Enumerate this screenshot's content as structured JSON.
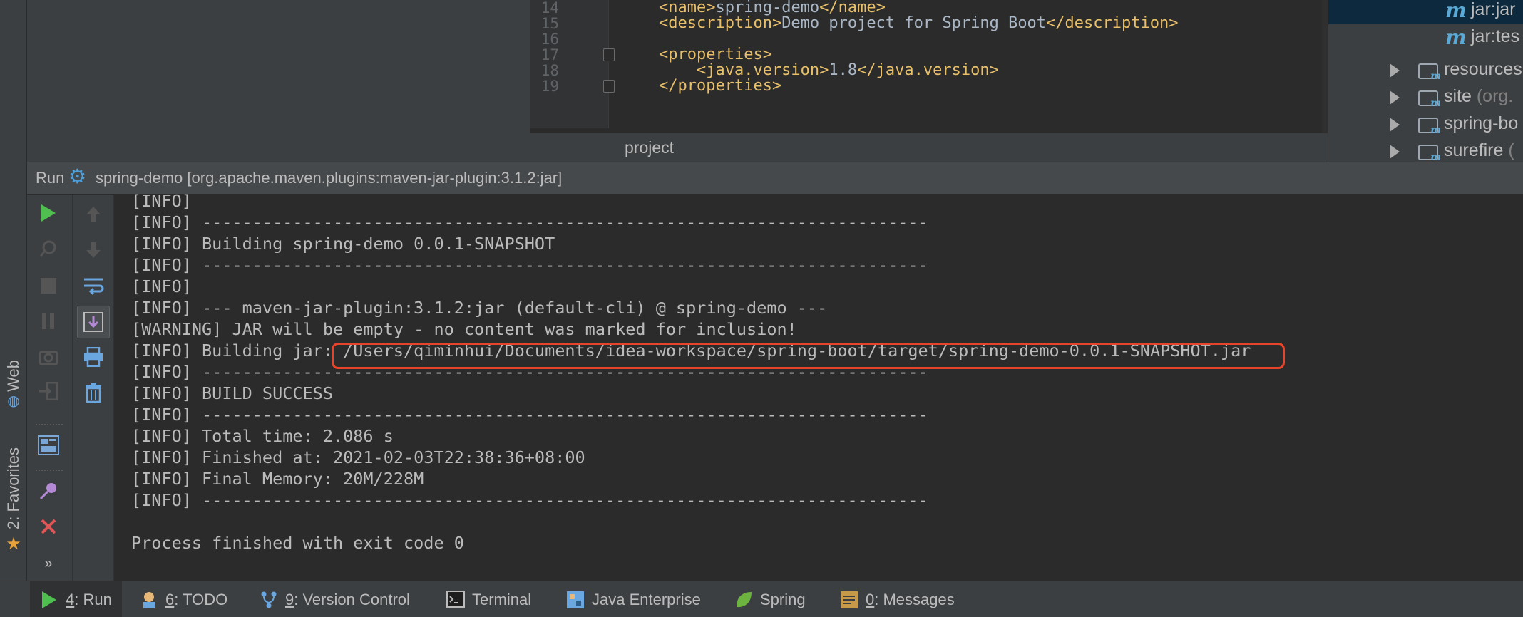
{
  "editor": {
    "lines": [
      {
        "no": "14",
        "parts": [
          [
            "tag",
            "<name>"
          ],
          [
            "txt",
            "spring-demo"
          ],
          [
            "tag",
            "</name>"
          ]
        ]
      },
      {
        "no": "15",
        "parts": [
          [
            "tag",
            "<description>"
          ],
          [
            "txt",
            "Demo project for Spring Boot"
          ],
          [
            "tag",
            "</description>"
          ]
        ]
      },
      {
        "no": "16",
        "parts": []
      },
      {
        "no": "17",
        "parts": [
          [
            "tag",
            "<properties>"
          ]
        ]
      },
      {
        "no": "18",
        "parts": [
          [
            "tag",
            "    <java.version>"
          ],
          [
            "txt",
            "1.8"
          ],
          [
            "tag",
            "</java.version>"
          ]
        ]
      },
      {
        "no": "19",
        "parts": [
          [
            "tag",
            "</properties>"
          ]
        ]
      }
    ],
    "breadcrumb": "project"
  },
  "maven_tree": {
    "items": [
      {
        "label": "jar:jar",
        "kind": "goal",
        "selected": true
      },
      {
        "label": "jar:tes",
        "kind": "goal",
        "selected": false
      },
      {
        "label": "resources",
        "kind": "plugin",
        "suffix": ""
      },
      {
        "label": "site",
        "kind": "plugin",
        "suffix": " (org."
      },
      {
        "label": "spring-bo",
        "kind": "plugin",
        "suffix": ""
      },
      {
        "label": "surefire",
        "kind": "plugin",
        "suffix": " ("
      }
    ]
  },
  "left_stripe": {
    "web": "Web",
    "favorites": "2: Favorites"
  },
  "run_panel": {
    "title": "Run",
    "config": "spring-demo [org.apache.maven.plugins:maven-jar-plugin:3.1.2:jar]"
  },
  "console": {
    "lines": [
      "[INFO]",
      "[INFO] ------------------------------------------------------------------------",
      "[INFO] Building spring-demo 0.0.1-SNAPSHOT",
      "[INFO] ------------------------------------------------------------------------",
      "[INFO]",
      "[INFO] --- maven-jar-plugin:3.1.2:jar (default-cli) @ spring-demo ---",
      "[WARNING] JAR will be empty - no content was marked for inclusion!",
      "[INFO] Building jar: /Users/qiminhui/Documents/idea-workspace/spring-boot/target/spring-demo-0.0.1-SNAPSHOT.jar",
      "[INFO] ------------------------------------------------------------------------",
      "[INFO] BUILD SUCCESS",
      "[INFO] ------------------------------------------------------------------------",
      "[INFO] Total time: 2.086 s",
      "[INFO] Finished at: 2021-02-03T22:38:36+08:00",
      "[INFO] Final Memory: 20M/228M",
      "[INFO] ------------------------------------------------------------------------",
      "",
      "Process finished with exit code 0"
    ]
  },
  "bottom_tabs": [
    {
      "key": "4",
      "label": ": Run",
      "icon": "run-icon",
      "active": true
    },
    {
      "key": "6",
      "label": ": TODO",
      "icon": "todo-icon",
      "active": false
    },
    {
      "key": "9",
      "label": ": Version Control",
      "icon": "version-control-icon",
      "active": false
    },
    {
      "key": "",
      "label": "Terminal",
      "icon": "terminal-icon",
      "active": false
    },
    {
      "key": "",
      "label": "Java Enterprise",
      "icon": "java-enterprise-icon",
      "active": false
    },
    {
      "key": "",
      "label": "Spring",
      "icon": "spring-icon",
      "active": false
    },
    {
      "key": "0",
      "label": ": Messages",
      "icon": "messages-icon",
      "active": false
    }
  ],
  "colors": {
    "background": "#2b2b2b",
    "panel": "#3c3f41",
    "xml_tag": "#e8bf6a",
    "highlight_box": "#e8432b",
    "run_green": "#4fbf4f",
    "stop_red": "#e05555"
  }
}
